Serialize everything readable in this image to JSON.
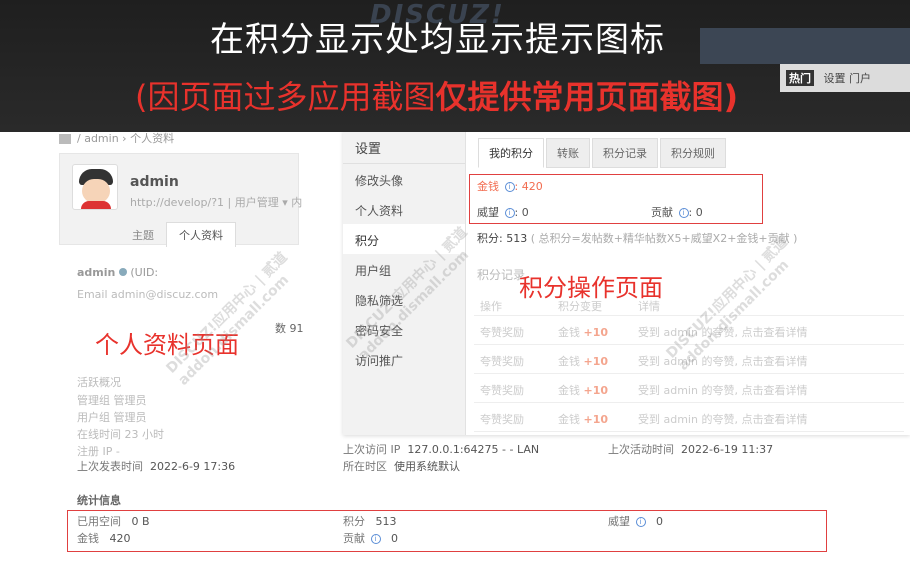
{
  "banner": {
    "title": "在积分显示处均显示提示图标",
    "subtitle_normal": "(因页面过多应用截图",
    "subtitle_bold": "仅提供常用页面截图)",
    "bg_logo": "DISCUZ!",
    "nav_mini_badge": "热门",
    "nav_mini_text": "设置 门户"
  },
  "profile": {
    "breadcrumb": {
      "user": "admin",
      "page": "个人资料"
    },
    "username": "admin",
    "url": "http://develop/?1",
    "user_manage": "用户管理 ▾",
    "user_manage_more": "内",
    "tabs": [
      "主题",
      "个人资料"
    ],
    "uid_line": "admin",
    "uid_extra": "(UID:",
    "email_label": "Email",
    "email_value": "admin@discuz.com",
    "stat_fragment": "数 91",
    "overview_label": "活跃概况",
    "section_label": "个人资料页面",
    "rows": {
      "admin_group": "管理组  管理员",
      "user_group": "用户组  管理员",
      "online_time": "在线时间  23 小时",
      "reg_ip": "注册 IP  -",
      "last_post": {
        "label": "上次发表时间",
        "value": "2022-6-9 17:36"
      },
      "last_ip": {
        "label": "上次访问 IP",
        "value": "127.0.0.1:64275 - - LAN"
      },
      "timezone": {
        "label": "所在时区",
        "value": "使用系统默认"
      },
      "last_active": {
        "label": "上次活动时间",
        "value": "2022-6-19 11:37"
      }
    },
    "stats": {
      "title": "统计信息",
      "used_space": {
        "label": "已用空间",
        "value": "0 B"
      },
      "credits": {
        "label": "积分",
        "value": "513"
      },
      "prestige": {
        "label": "威望",
        "value": "0"
      },
      "money": {
        "label": "金钱",
        "value": "420"
      },
      "contribution": {
        "label": "贡献",
        "value": "0"
      }
    }
  },
  "credit_page": {
    "section_label": "积分操作页面",
    "sidebar": {
      "title": "设置",
      "items": [
        "修改头像",
        "个人资料",
        "积分",
        "用户组",
        "隐私筛选",
        "密码安全",
        "访问推广"
      ]
    },
    "tabs": [
      "我的积分",
      "转账",
      "积分记录",
      "积分规则"
    ],
    "money": {
      "label": "金钱",
      "value": "420"
    },
    "prestige": {
      "label": "威望",
      "value": "0"
    },
    "contribution": {
      "label": "贡献",
      "value": "0"
    },
    "total": {
      "label": "积分: 513",
      "formula": "( 总积分=发帖数+精华帖数X5+威望X2+金钱+贡献 )"
    },
    "records_label": "积分记录",
    "table": {
      "headers": [
        "操作",
        "积分变更",
        "详情"
      ],
      "rows": [
        {
          "op": "夸赞奖励",
          "change_label": "金钱",
          "change_value": "+10",
          "detail": "受到 admin 的夸赞, 点击查看详情"
        },
        {
          "op": "夸赞奖励",
          "change_label": "金钱",
          "change_value": "+10",
          "detail": "受到 admin 的夸赞, 点击查看详情"
        },
        {
          "op": "夸赞奖励",
          "change_label": "金钱",
          "change_value": "+10",
          "detail": "受到 admin 的夸赞, 点击查看详情"
        },
        {
          "op": "夸赞奖励",
          "change_label": "金钱",
          "change_value": "+10",
          "detail": "受到 admin 的夸赞, 点击查看详情"
        }
      ]
    }
  },
  "watermark": {
    "line1": "DISCUZ!应用中心 | 贰道",
    "line2": "addon.dismall.com"
  },
  "colors": {
    "accent_red": "#e8322c",
    "box_red": "#e04040",
    "money_orange": "#f26c4f",
    "info_blue": "#5a8dd6"
  }
}
